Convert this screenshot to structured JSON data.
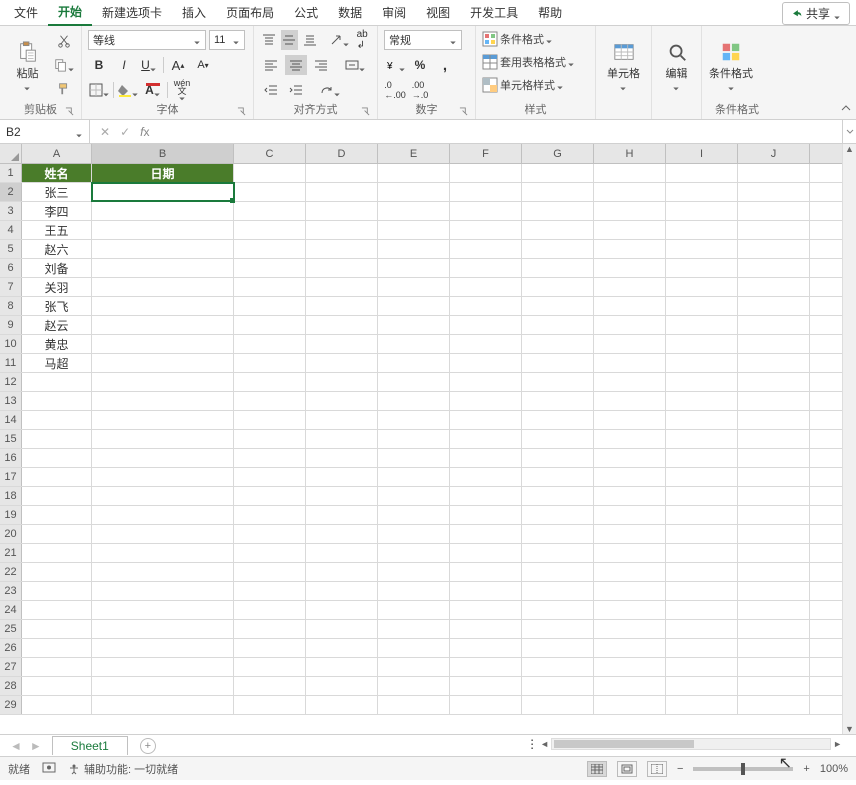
{
  "tabs": [
    "文件",
    "开始",
    "新建选项卡",
    "插入",
    "页面布局",
    "公式",
    "数据",
    "审阅",
    "视图",
    "开发工具",
    "帮助"
  ],
  "active_tab_index": 1,
  "share_label": "共享",
  "ribbon": {
    "clipboard": {
      "paste": "粘贴",
      "label": "剪贴板"
    },
    "font": {
      "name": "等线",
      "size": "11",
      "label": "字体"
    },
    "align": {
      "label": "对齐方式"
    },
    "number": {
      "format": "常规",
      "label": "数字"
    },
    "styles": {
      "cond": "条件格式",
      "table": "套用表格格式",
      "cell": "单元格样式",
      "label": "样式"
    },
    "cells": {
      "label": "单元格"
    },
    "editing": {
      "label": "编辑"
    },
    "cond2": {
      "label": "条件格式"
    }
  },
  "name_box": "B2",
  "col_headers": [
    "A",
    "B",
    "C",
    "D",
    "E",
    "F",
    "G",
    "H",
    "I",
    "J"
  ],
  "header_row": {
    "a": "姓名",
    "b": "日期"
  },
  "names": [
    "张三",
    "李四",
    "王五",
    "赵六",
    "刘备",
    "关羽",
    "张飞",
    "赵云",
    "黄忠",
    "马超"
  ],
  "visible_row_count": 29,
  "sheet_name": "Sheet1",
  "status": {
    "ready": "就绪",
    "acc": "辅助功能: 一切就绪",
    "zoom": "100%"
  }
}
